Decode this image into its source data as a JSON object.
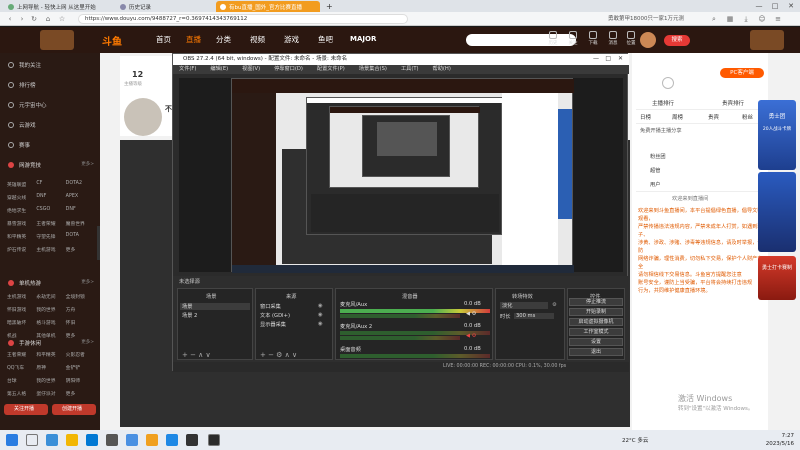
{
  "browser": {
    "tabs": [
      {
        "label": "上网导航 - 轻快上网 从这里开始"
      },
      {
        "label": "历史记录"
      },
      {
        "label": "有bu直播_国外_官方比赛直播"
      }
    ],
    "url": "https://www.douyu.com/9488727_r=0.3697414343769112",
    "search_hint": "勇敢第甲18000只一家1万元测",
    "window_controls": {
      "min": "—",
      "max": "□",
      "close": "✕"
    }
  },
  "site": {
    "logo_text": "斗鱼",
    "nav": [
      "首页",
      "直播",
      "分类",
      "视频",
      "游戏",
      "鱼吧"
    ],
    "active_nav": "直播",
    "major_label": "MAJOR",
    "search_button": "搜索",
    "header_icons": [
      "历史",
      "关注",
      "下载",
      "消息",
      "位置"
    ]
  },
  "sidebar": {
    "items": [
      "我的关注",
      "排行榜",
      "元宇宙中心",
      "云游戏",
      "赛事"
    ],
    "hot_category_title": "网游竞技",
    "hot_grid": [
      "英雄联盟",
      "CF",
      "DOTA2",
      "穿越火线",
      "DNF",
      "APEX",
      "绝地求生",
      "CSGO",
      "DNF",
      "暴雪游戏",
      "王者荣耀",
      "魔兽世界",
      "和平精英",
      "守望先锋",
      "DOTA",
      "炉石传说",
      "主机游戏",
      "更多"
    ],
    "single_category_title": "单机热游",
    "single_grid": [
      "主机游戏",
      "永劫无间",
      "全境封锁",
      "怀旧游戏",
      "我的世界",
      "方舟",
      "暗黑破坏",
      "格斗游戏",
      "怀旧",
      "机战",
      "其他单机",
      "更多"
    ],
    "mobile_category_title": "手游休闲",
    "mobile_grid": [
      "王者荣耀",
      "和平精英",
      "火影忍者",
      "QQ飞车",
      "原神",
      "金铲铲",
      "台球",
      "我的世界",
      "阴阳师",
      "第五人格",
      "蛋仔派对",
      "更多"
    ],
    "more_label": "更多>",
    "btn_follow": "关注开播",
    "btn_create": "创建开播"
  },
  "room": {
    "level": "12",
    "level_label": "主播等级",
    "anchor_name": "不"
  },
  "right_panel": {
    "pc_client": "PC客户端",
    "tabs": [
      "日榜",
      "周榜",
      "贵宾",
      "粉丝"
    ],
    "rank_items": [
      "主播排行",
      "贵宾排行"
    ],
    "notice_title": "免费开播主播分享",
    "rank_rows": [
      "粉丝团",
      "超管",
      "用户"
    ],
    "announce_title": "欢迎来到直播间",
    "chat_lines": [
      "欢迎来到斗鱼直播间，本平台提倡绿色直播，倡导文明观看，",
      "严禁传播违法违规内容，严禁未成年人打赏，如遇到骗子、",
      "涉黄、涉政、涉赌、涉毒等违规信息，请及时举报，谨防",
      "网络诈骗，理性消费，切勿私下交易，保护个人财产安全",
      "请勿相信线下交易信息。斗鱼官方提醒您注意",
      "账号安全，谨防上当受骗，平台将会持续打击违规",
      "行为，共同维护健康直播环境。"
    ]
  },
  "ads": {
    "top": "勇士团",
    "mid": "20人战斗卡牌",
    "bottom": "勇士打卡赛制"
  },
  "obs": {
    "title": "OBS 27.2.4 (64 bit, windows) - 配置文件: 未命名 - 场景: 未命名",
    "menu": [
      "文件(F)",
      "编辑(E)",
      "视图(V)",
      "停靠窗口(D)",
      "配置文件(P)",
      "场景集合(S)",
      "工具(T)",
      "帮助(H)"
    ],
    "no_source": "未选择源",
    "docks": {
      "scenes": {
        "title": "场景",
        "items": [
          "场景",
          "场景 2"
        ]
      },
      "sources": {
        "title": "来源",
        "items": [
          "窗口采集",
          "文本 (GDI+)",
          "显示器采集"
        ]
      },
      "mixer": {
        "title": "混音器",
        "channels": [
          {
            "name": "麦克风/Aux",
            "db": "0.0 dB"
          },
          {
            "name": "麦克风/Aux 2",
            "db": "0.0 dB"
          },
          {
            "name": "桌面音频",
            "db": "0.0 dB"
          }
        ]
      },
      "transition": {
        "title": "转场特效",
        "type": "淡化",
        "duration_label": "时长",
        "duration": "300 ms"
      },
      "controls": {
        "title": "控件",
        "buttons": [
          "停止推流",
          "开始录制",
          "启动虚拟摄像机",
          "工作室模式",
          "设置",
          "退出"
        ]
      }
    },
    "status": "LIVE: 00:00:00    REC: 00:00:00    CPU: 0.1%, 30.00 fps"
  },
  "watermark": {
    "title": "激活 Windows",
    "sub": "转到\"设置\"以激活 Windows。"
  },
  "taskbar": {
    "weather": "22°C 多云",
    "time": "7:27",
    "date": "2023/5/16"
  },
  "colors": {
    "douyu_header": "#2b1710",
    "accent_orange": "#ff7a00",
    "obs_bg": "#2b2b2b",
    "search_red": "#e53935"
  }
}
